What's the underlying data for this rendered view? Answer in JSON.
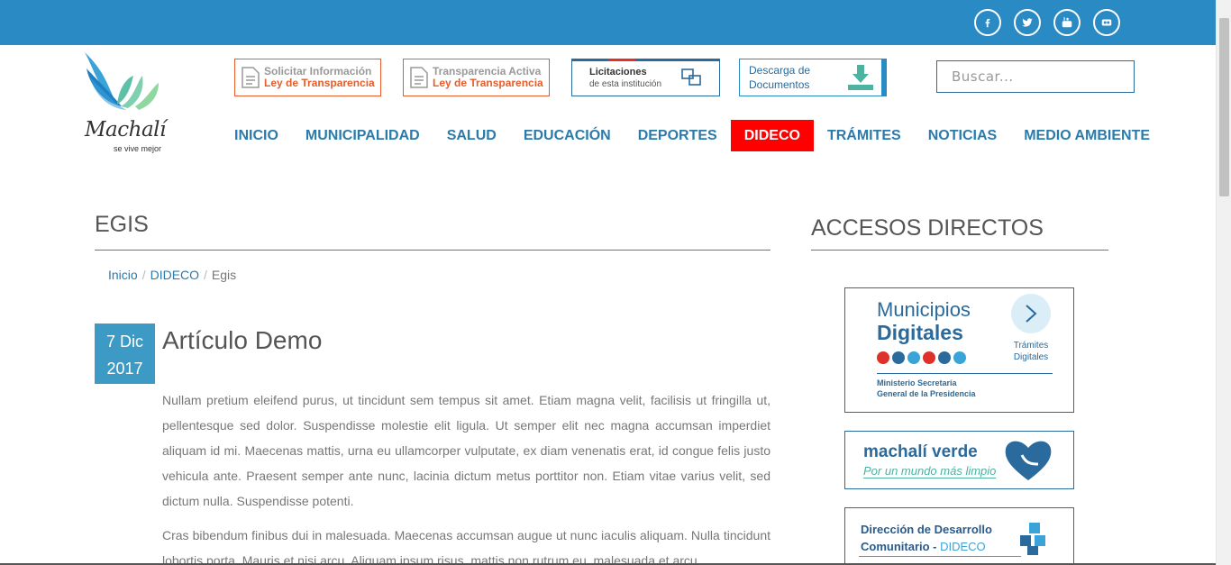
{
  "topbar": {
    "social": [
      {
        "name": "facebook-icon",
        "glyph": "f"
      },
      {
        "name": "twitter-icon",
        "glyph": ""
      },
      {
        "name": "youtube-icon",
        "glyph": ""
      },
      {
        "name": "flickr-icon",
        "glyph": ""
      }
    ]
  },
  "logo": {
    "word": "Machalí",
    "tagline": "se vive mejor"
  },
  "quick_links": {
    "solicitar": {
      "line1": "Solicitar Información",
      "line2": "Ley de Transparencia"
    },
    "transparencia": {
      "line1": "Transparencia Activa",
      "line2": "Ley de Transparencia"
    },
    "licitaciones": {
      "line1": "Licitaciones",
      "line2": "de esta institución"
    },
    "descarga": {
      "line1": "Descarga de",
      "line2": "Documentos"
    }
  },
  "search": {
    "placeholder": "Buscar..."
  },
  "nav": {
    "items": [
      "INICIO",
      "MUNICIPALIDAD",
      "SALUD",
      "EDUCACIÓN",
      "DEPORTES",
      "DIDECO",
      "TRÁMITES",
      "NOTICIAS",
      "MEDIO AMBIENTE"
    ],
    "active": "DIDECO"
  },
  "page": {
    "title": "EGIS",
    "breadcrumb": {
      "home": "Inicio",
      "section": "DIDECO",
      "current": "Egis",
      "sep": "/"
    }
  },
  "article": {
    "date_day": "7 Dic",
    "date_year": "2017",
    "title": "Artículo Demo",
    "p1": "Nullam pretium eleifend purus, ut tincidunt sem tempus sit amet. Etiam magna velit, facilisis ut fringilla ut, pellentesque sed dolor. Suspendisse molestie elit ligula. Ut semper elit nec magna accumsan imperdiet aliquam id mi. Maecenas mattis, urna eu ullamcorper vulputate, ex diam venenatis erat, id congue felis justo vehicula ante. Praesent semper ante nunc, lacinia dictum metus porttitor non. Etiam vitae varius velit, sed dictum nulla. Suspendisse potenti.",
    "p2": "Cras bibendum finibus dui in malesuada. Maecenas accumsan augue ut nunc iaculis aliquam. Nulla tincidunt lobortis porta. Mauris et nisi arcu. Aliquam ipsum risus, mattis non rutrum eu, malesuada et arcu."
  },
  "sidebar": {
    "title": "ACCESOS DIRECTOS",
    "municipios": {
      "line1": "Municipios",
      "line2": "Digitales",
      "tramites1": "Trámites",
      "tramites2": "Digitales",
      "ministerio1": "Ministerio Secretaría",
      "ministerio2": "General de la Presidencia"
    },
    "verde": {
      "title": "machalí verde",
      "sub": "Por un mundo más limpio"
    },
    "dideco": {
      "line1": "Dirección de Desarrollo",
      "line2a": "Comunitario - ",
      "line2b": "DIDECO"
    }
  },
  "colors": {
    "primary": "#2a8ac4",
    "active_nav": "#ff0000",
    "orange": "#e85c2c",
    "dark_blue": "#2a6a9c"
  }
}
